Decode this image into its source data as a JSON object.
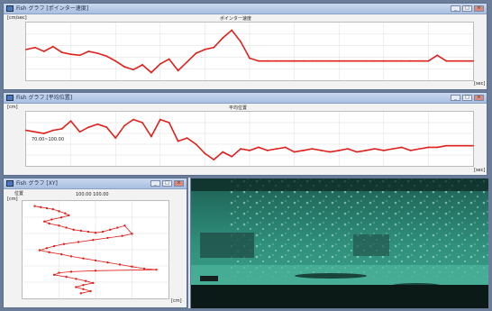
{
  "windows": {
    "speed": {
      "title": "Fish グラフ [ポインター速度]",
      "chart_title": "ポインター速度",
      "ylabel": "[cm/sec]",
      "xlabel": "[sec]"
    },
    "depth": {
      "title": "Fish グラフ [平均位置]",
      "chart_title": "平均位置",
      "ylabel": "[cm]",
      "xlabel": "[sec]",
      "annotation": "70.00~100.00"
    },
    "track": {
      "title": "Fish グラフ [XY]",
      "chart_title": "位置",
      "subtitle": "100.00 100.00",
      "ylabel": "[cm]",
      "xlabel": "[cm]"
    }
  },
  "window_buttons": [
    "_",
    "□",
    "×"
  ],
  "video": {
    "caption": "",
    "colors": {
      "water": "#2f8f7a",
      "floor": "#38a08a",
      "dark": "#0b1a17"
    }
  },
  "colors": {
    "series": "#e0201c",
    "accent": "#4a76c0"
  },
  "chart_data": [
    {
      "type": "line",
      "title": "ポインター速度",
      "ylabel": "[cm/sec]",
      "xlabel": "[sec]",
      "x": [
        0,
        2,
        4,
        6,
        8,
        10,
        12,
        14,
        16,
        18,
        20,
        22,
        24,
        26,
        28,
        30,
        32,
        34,
        36,
        38,
        40,
        42,
        44,
        46,
        48,
        50,
        52,
        54,
        56,
        58,
        60,
        62,
        64,
        66,
        68,
        70,
        72,
        74,
        76,
        78,
        80,
        82,
        84,
        86,
        88,
        90,
        92,
        94,
        96,
        98,
        100
      ],
      "y": [
        12,
        14,
        10,
        15,
        9,
        7,
        6,
        10,
        8,
        5,
        0,
        -6,
        -9,
        -4,
        -12,
        -3,
        2,
        -10,
        -1,
        8,
        12,
        14,
        24,
        32,
        20,
        3,
        0,
        0,
        0,
        0,
        0,
        0,
        0,
        0,
        0,
        0,
        0,
        0,
        0,
        0,
        0,
        0,
        0,
        0,
        0,
        0,
        6,
        0,
        0,
        0,
        0
      ],
      "ylim": [
        -20,
        40
      ],
      "xlim": [
        0,
        100
      ]
    },
    {
      "type": "line",
      "title": "平均位置",
      "ylabel": "[cm]",
      "xlabel": "[sec]",
      "x": [
        0,
        2,
        4,
        6,
        8,
        10,
        12,
        14,
        16,
        18,
        20,
        22,
        24,
        26,
        28,
        30,
        32,
        34,
        36,
        38,
        40,
        42,
        44,
        46,
        48,
        50,
        52,
        54,
        56,
        58,
        60,
        62,
        64,
        66,
        68,
        70,
        72,
        74,
        76,
        78,
        80,
        82,
        84,
        86,
        88,
        90,
        92,
        94,
        96,
        98,
        100
      ],
      "y": [
        93,
        92,
        91,
        93,
        94,
        99,
        92,
        95,
        97,
        95,
        88,
        96,
        100,
        98,
        89,
        100,
        98,
        86,
        88,
        84,
        78,
        74,
        79,
        76,
        81,
        80,
        82,
        80,
        81,
        82,
        79,
        80,
        81,
        80,
        79,
        80,
        81,
        79,
        80,
        81,
        80,
        81,
        82,
        80,
        81,
        82,
        82,
        83,
        83,
        83,
        83
      ],
      "ylim": [
        70,
        105
      ],
      "xlim": [
        0,
        100
      ]
    },
    {
      "type": "scatter",
      "title": "位置",
      "xlabel": "[cm]",
      "ylabel": "[cm]",
      "x": [
        -20,
        -15,
        -10,
        -5,
        0,
        5,
        8,
        2,
        -6,
        -12,
        -8,
        0,
        6,
        12,
        18,
        24,
        30,
        36,
        42,
        48,
        54,
        60,
        52,
        40,
        28,
        16,
        4,
        -4,
        -10,
        -16,
        -8,
        2,
        10,
        20,
        30,
        40,
        50,
        60,
        70,
        80,
        30,
        10,
        0,
        -4,
        6,
        14,
        22,
        28,
        20,
        14,
        20,
        26,
        18
      ],
      "y": [
        95,
        94,
        93,
        92,
        90,
        88,
        86,
        84,
        82,
        80,
        78,
        76,
        74,
        72,
        71,
        70,
        69,
        70,
        72,
        74,
        76,
        68,
        66,
        64,
        62,
        60,
        58,
        56,
        54,
        52,
        50,
        48,
        46,
        44,
        42,
        40,
        38,
        36,
        34,
        33,
        32,
        31,
        30,
        28,
        26,
        24,
        22,
        20,
        18,
        16,
        14,
        12,
        10
      ],
      "xlim": [
        -30,
        90
      ],
      "ylim": [
        5,
        100
      ]
    }
  ]
}
